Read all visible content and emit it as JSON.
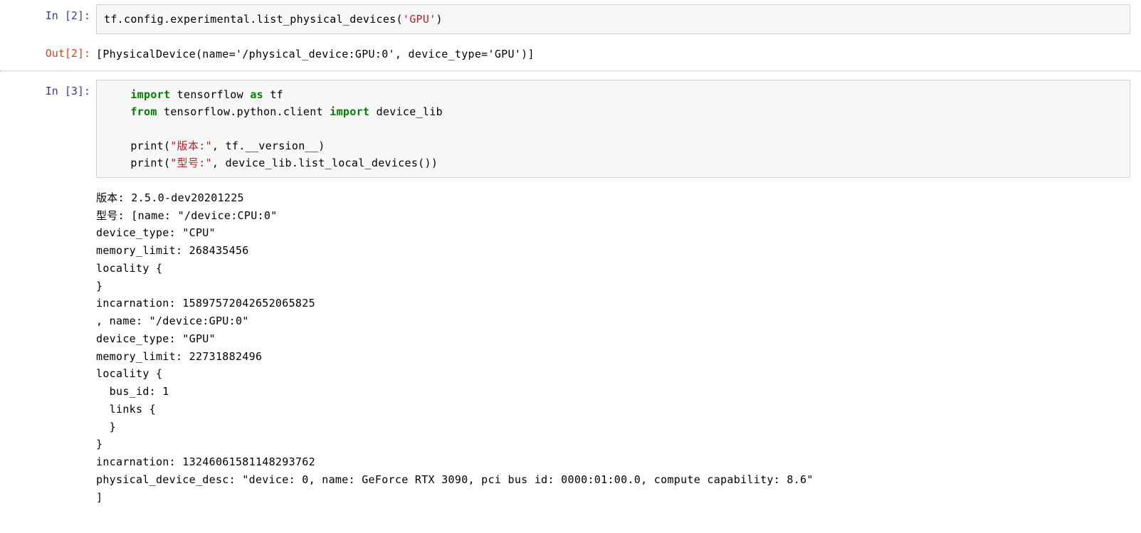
{
  "cells": {
    "cell1": {
      "prompt_in": "In  [2]:",
      "prompt_out": "Out[2]:",
      "code_prefix": "tf.config.experimental.list_physical_devices(",
      "code_arg": "'GPU'",
      "code_suffix": ")",
      "output": "[PhysicalDevice(name='/physical_device:GPU:0', device_type='GPU')]"
    },
    "cell2": {
      "prompt_in": "In  [3]:",
      "code": {
        "indent": "    ",
        "l1_kw1": "import",
        "l1_rest": " tensorflow ",
        "l1_kw2": "as",
        "l1_rest2": " tf",
        "l2_kw1": "from",
        "l2_rest": " tensorflow.python.client ",
        "l2_kw2": "import",
        "l2_rest2": " device_lib",
        "l4_pre": "print(",
        "l4_str": "\"版本:\"",
        "l4_mid": ", tf.__version__)",
        "l5_pre": "print(",
        "l5_str": "\"型号:\"",
        "l5_mid": ", device_lib.list_local_devices())"
      },
      "output": "版本: 2.5.0-dev20201225\n型号: [name: \"/device:CPU:0\"\ndevice_type: \"CPU\"\nmemory_limit: 268435456\nlocality {\n}\nincarnation: 15897572042652065825\n, name: \"/device:GPU:0\"\ndevice_type: \"GPU\"\nmemory_limit: 22731882496\nlocality {\n  bus_id: 1\n  links {\n  }\n}\nincarnation: 13246061581148293762\nphysical_device_desc: \"device: 0, name: GeForce RTX 3090, pci bus id: 0000:01:00.0, compute capability: 8.6\"\n]"
    }
  }
}
